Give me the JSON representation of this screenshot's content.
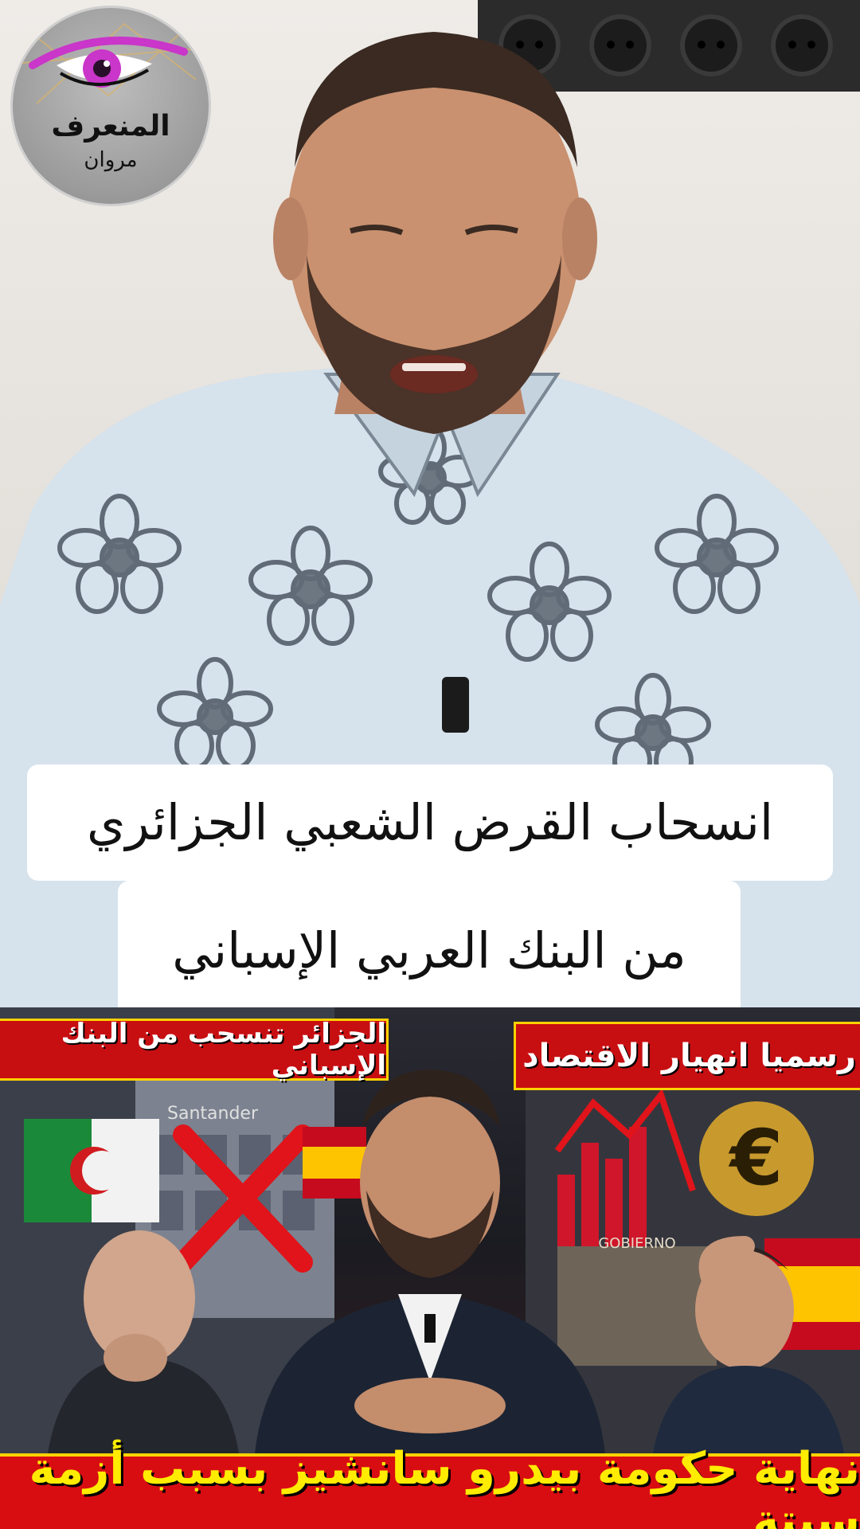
{
  "logo": {
    "name": "المنعرف",
    "sub": "مروان"
  },
  "caption": {
    "line1": "انسحاب القرض الشعبي الجزائري",
    "line2": "من البنك العربي الإسباني"
  },
  "thumbnail": {
    "banner_left": "الجزائر تنسحب من البنك الإسباني",
    "banner_right": "رسميا انهيار الاقتصاد",
    "banner_bottom": "نهاية حكومة بيدرو سانشيز بسبب أزمة سبتة",
    "sign_building": "GOBIERNO",
    "sign_bank": "Santander",
    "euro_symbol": "€"
  },
  "colors": {
    "banner_red": "#c70f12",
    "banner_yellow_text": "#ffec00",
    "logo_eye": "#c936c9",
    "caption_bg": "#ffffff"
  }
}
